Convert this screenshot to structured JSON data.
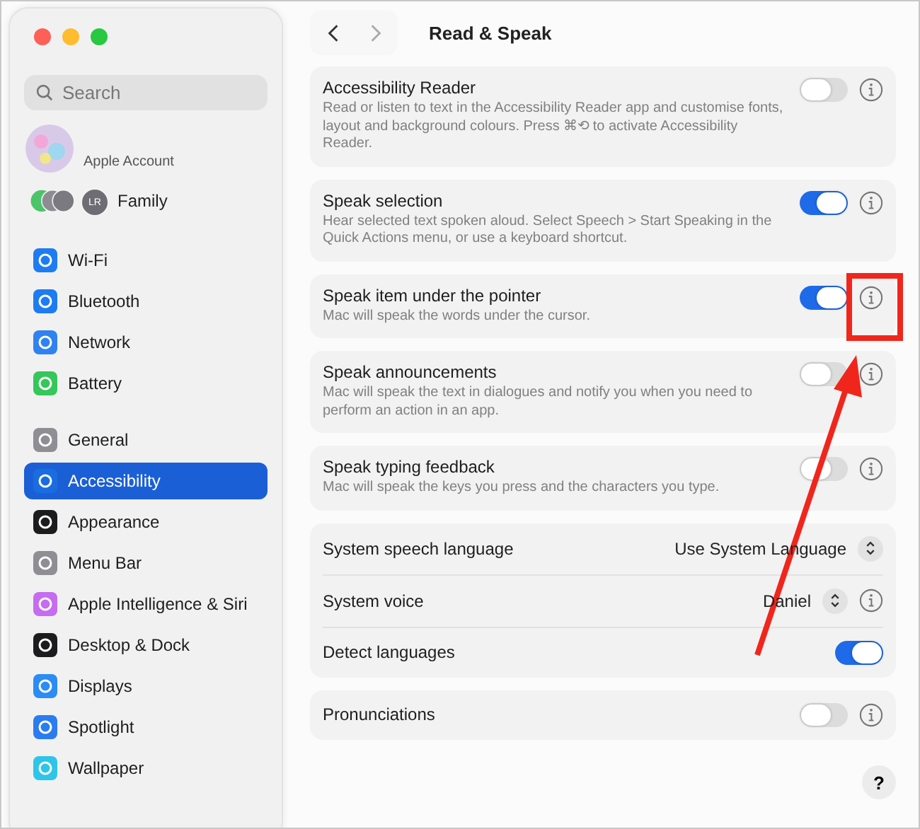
{
  "window": {
    "title": "Read & Speak"
  },
  "search": {
    "placeholder": "Search"
  },
  "account": {
    "subtitle": "Apple Account"
  },
  "family": {
    "label": "Family",
    "members": [
      "LR"
    ]
  },
  "sidebar": {
    "groups": [
      [
        {
          "label": "Wi-Fi",
          "selected": false
        },
        {
          "label": "Bluetooth",
          "selected": false
        },
        {
          "label": "Network",
          "selected": false
        },
        {
          "label": "Battery",
          "selected": false
        }
      ],
      [
        {
          "label": "General",
          "selected": false
        },
        {
          "label": "Accessibility",
          "selected": true
        },
        {
          "label": "Appearance",
          "selected": false
        },
        {
          "label": "Menu Bar",
          "selected": false
        },
        {
          "label": "Apple Intelligence & Siri",
          "selected": false
        },
        {
          "label": "Desktop & Dock",
          "selected": false
        },
        {
          "label": "Displays",
          "selected": false
        },
        {
          "label": "Spotlight",
          "selected": false
        },
        {
          "label": "Wallpaper",
          "selected": false
        }
      ]
    ]
  },
  "groups": [
    [
      {
        "kind": "toggle",
        "label": "Accessibility Reader",
        "description": "Read or listen to text in the Accessibility Reader app and customise fonts, layout and background colours. Press ⌘⟲ to activate Accessibility Reader.",
        "on": false,
        "info": true
      }
    ],
    [
      {
        "kind": "toggle",
        "label": "Speak selection",
        "description": "Hear selected text spoken aloud. Select Speech > Start Speaking in the Quick Actions menu, or use a keyboard shortcut.",
        "on": true,
        "info": true
      }
    ],
    [
      {
        "kind": "toggle",
        "label": "Speak item under the pointer",
        "description": "Mac will speak the words under the cursor.",
        "on": true,
        "info": true
      }
    ],
    [
      {
        "kind": "toggle",
        "label": "Speak announcements",
        "description": "Mac will speak the text in dialogues and notify you when you need to perform an action in an app.",
        "on": false,
        "info": true
      }
    ],
    [
      {
        "kind": "toggle",
        "label": "Speak typing feedback",
        "description": "Mac will speak the keys you press and the characters you type.",
        "on": false,
        "info": true
      }
    ],
    [
      {
        "kind": "popup",
        "label": "System speech language",
        "value": "Use System Language",
        "info": false
      },
      {
        "kind": "popup",
        "label": "System voice",
        "value": "Daniel",
        "info": true
      },
      {
        "kind": "toggle",
        "label": "Detect languages",
        "on": true,
        "info": false
      }
    ],
    [
      {
        "kind": "toggle",
        "label": "Pronunciations",
        "on": false,
        "info": true
      }
    ]
  ],
  "help": {
    "label": "?"
  }
}
